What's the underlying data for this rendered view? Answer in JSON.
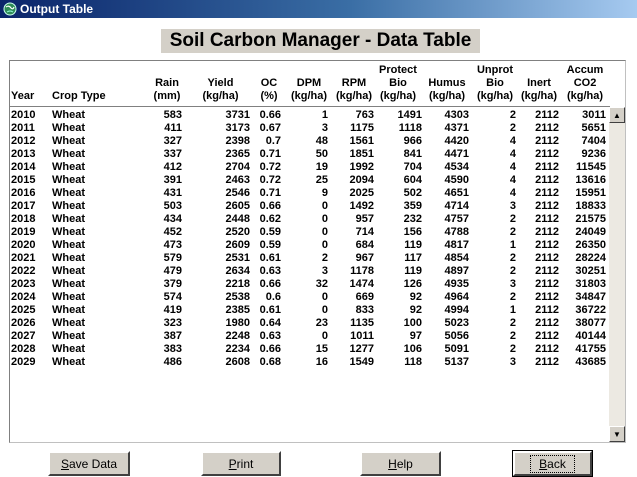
{
  "window": {
    "title": "Output Table"
  },
  "heading": "Soil Carbon Manager - Data Table",
  "table": {
    "columns": [
      {
        "key": "year",
        "lines": [
          "Year"
        ]
      },
      {
        "key": "crop",
        "lines": [
          "Crop Type"
        ]
      },
      {
        "key": "rain",
        "lines": [
          "Rain",
          "(mm)"
        ]
      },
      {
        "key": "yield",
        "lines": [
          "Yield",
          "(kg/ha)"
        ]
      },
      {
        "key": "oc",
        "lines": [
          "OC",
          "(%)"
        ]
      },
      {
        "key": "dpm",
        "lines": [
          "DPM",
          "(kg/ha)"
        ]
      },
      {
        "key": "rpm",
        "lines": [
          "RPM",
          "(kg/ha)"
        ]
      },
      {
        "key": "protect",
        "lines": [
          "Protect",
          "Bio",
          "(kg/ha)"
        ]
      },
      {
        "key": "humus",
        "lines": [
          "Humus",
          "(kg/ha)"
        ]
      },
      {
        "key": "unprot",
        "lines": [
          "Unprot",
          "Bio",
          "(kg/ha)"
        ]
      },
      {
        "key": "inert",
        "lines": [
          "Inert",
          "(kg/ha)"
        ]
      },
      {
        "key": "co2",
        "lines": [
          "Accum",
          "CO2",
          "(kg/ha)"
        ]
      }
    ],
    "rows": [
      [
        "2010",
        "Wheat",
        "583",
        "3731",
        "0.66",
        "1",
        "763",
        "1491",
        "4303",
        "2",
        "2112",
        "3011"
      ],
      [
        "2011",
        "Wheat",
        "411",
        "3173",
        "0.67",
        "3",
        "1175",
        "1118",
        "4371",
        "2",
        "2112",
        "5651"
      ],
      [
        "2012",
        "Wheat",
        "327",
        "2398",
        "0.7",
        "48",
        "1561",
        "966",
        "4420",
        "4",
        "2112",
        "7404"
      ],
      [
        "2013",
        "Wheat",
        "337",
        "2365",
        "0.71",
        "50",
        "1851",
        "841",
        "4471",
        "4",
        "2112",
        "9236"
      ],
      [
        "2014",
        "Wheat",
        "412",
        "2704",
        "0.72",
        "19",
        "1992",
        "704",
        "4534",
        "4",
        "2112",
        "11545"
      ],
      [
        "2015",
        "Wheat",
        "391",
        "2463",
        "0.72",
        "25",
        "2094",
        "604",
        "4590",
        "4",
        "2112",
        "13616"
      ],
      [
        "2016",
        "Wheat",
        "431",
        "2546",
        "0.71",
        "9",
        "2025",
        "502",
        "4651",
        "4",
        "2112",
        "15951"
      ],
      [
        "2017",
        "Wheat",
        "503",
        "2605",
        "0.66",
        "0",
        "1492",
        "359",
        "4714",
        "3",
        "2112",
        "18833"
      ],
      [
        "2018",
        "Wheat",
        "434",
        "2448",
        "0.62",
        "0",
        "957",
        "232",
        "4757",
        "2",
        "2112",
        "21575"
      ],
      [
        "2019",
        "Wheat",
        "452",
        "2520",
        "0.59",
        "0",
        "714",
        "156",
        "4788",
        "2",
        "2112",
        "24049"
      ],
      [
        "2020",
        "Wheat",
        "473",
        "2609",
        "0.59",
        "0",
        "684",
        "119",
        "4817",
        "1",
        "2112",
        "26350"
      ],
      [
        "2021",
        "Wheat",
        "579",
        "2531",
        "0.61",
        "2",
        "967",
        "117",
        "4854",
        "2",
        "2112",
        "28224"
      ],
      [
        "2022",
        "Wheat",
        "479",
        "2634",
        "0.63",
        "3",
        "1178",
        "119",
        "4897",
        "2",
        "2112",
        "30251"
      ],
      [
        "2023",
        "Wheat",
        "379",
        "2218",
        "0.66",
        "32",
        "1474",
        "126",
        "4935",
        "3",
        "2112",
        "31803"
      ],
      [
        "2024",
        "Wheat",
        "574",
        "2538",
        "0.6",
        "0",
        "669",
        "92",
        "4964",
        "2",
        "2112",
        "34847"
      ],
      [
        "2025",
        "Wheat",
        "419",
        "2385",
        "0.61",
        "0",
        "833",
        "92",
        "4994",
        "1",
        "2112",
        "36722"
      ],
      [
        "2026",
        "Wheat",
        "323",
        "1980",
        "0.64",
        "23",
        "1135",
        "100",
        "5023",
        "2",
        "2112",
        "38077"
      ],
      [
        "2027",
        "Wheat",
        "387",
        "2248",
        "0.63",
        "0",
        "1011",
        "97",
        "5056",
        "2",
        "2112",
        "40144"
      ],
      [
        "2028",
        "Wheat",
        "383",
        "2234",
        "0.66",
        "15",
        "1277",
        "106",
        "5091",
        "2",
        "2112",
        "41755"
      ],
      [
        "2029",
        "Wheat",
        "486",
        "2608",
        "0.68",
        "16",
        "1549",
        "118",
        "5137",
        "3",
        "2112",
        "43685"
      ]
    ]
  },
  "scrollbar": {
    "up_icon": "triangle-up-icon",
    "down_icon": "triangle-down-icon"
  },
  "buttons": {
    "save": {
      "mnemonic": "S",
      "rest": "ave Data"
    },
    "print": {
      "mnemonic": "P",
      "rest": "rint"
    },
    "help": {
      "mnemonic": "H",
      "rest": "elp"
    },
    "back": {
      "mnemonic": "B",
      "rest": "ack"
    }
  },
  "colors": {
    "titlebar_start": "#0a246a",
    "titlebar_end": "#a6caf0",
    "button_face": "#d4d0c8"
  }
}
